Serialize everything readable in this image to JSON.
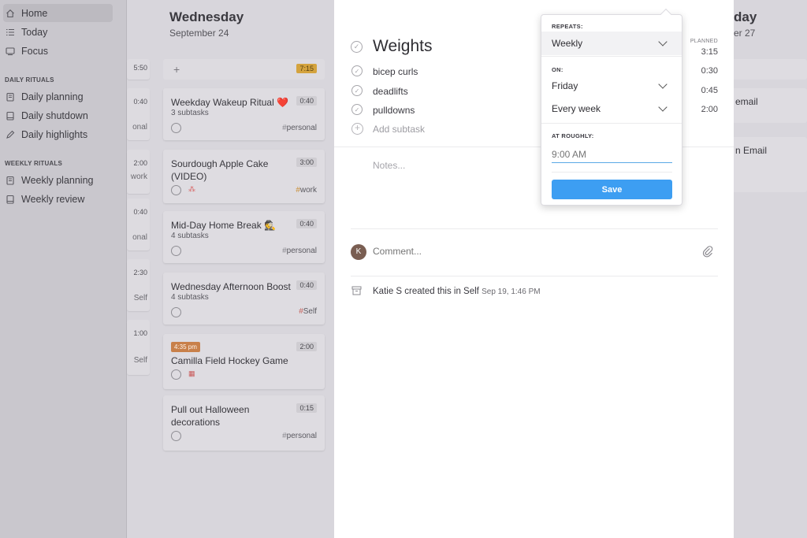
{
  "sidebar": {
    "items": [
      {
        "label": "Home",
        "icon": "home-icon"
      },
      {
        "label": "Today",
        "icon": "list-icon"
      },
      {
        "label": "Focus",
        "icon": "focus-icon"
      }
    ],
    "daily_rituals_heading": "DAILY RITUALS",
    "daily_rituals": [
      {
        "label": "Daily planning",
        "icon": "clipboard-icon"
      },
      {
        "label": "Daily shutdown",
        "icon": "notebook-icon"
      },
      {
        "label": "Daily highlights",
        "icon": "pen-icon"
      }
    ],
    "weekly_rituals_heading": "WEEKLY RITUALS",
    "weekly_rituals": [
      {
        "label": "Weekly planning",
        "icon": "clipboard-icon"
      },
      {
        "label": "Weekly review",
        "icon": "notebook-icon"
      }
    ]
  },
  "left_column": {
    "cards": [
      {
        "time": "5:50",
        "tag": ""
      },
      {
        "time": "0:40",
        "tag": "onal"
      },
      {
        "time": "2:00",
        "tag": "work"
      },
      {
        "time": "0:40",
        "tag": "onal"
      },
      {
        "time": "2:30",
        "tag": "Self"
      },
      {
        "time": "1:00",
        "tag": "Self"
      }
    ]
  },
  "wednesday": {
    "title": "Wednesday",
    "date": "September 24",
    "add_symbol": "+",
    "total": "7:15",
    "cards": [
      {
        "title": "Weekday Wakeup Ritual ❤️",
        "time": "0:40",
        "subtasks": "3 subtasks",
        "tag": "personal"
      },
      {
        "title": "Sourdough Apple Cake (VIDEO)",
        "time": "3:00",
        "subtasks": "",
        "tag": "work"
      },
      {
        "title": "Mid-Day Home Break 🕵️",
        "time": "0:40",
        "subtasks": "4 subtasks",
        "tag": "personal"
      },
      {
        "title": "Wednesday Afternoon Boost",
        "time": "0:40",
        "subtasks": "4 subtasks",
        "tag": "Self"
      },
      {
        "title": "Camilla Field Hockey Game",
        "time": "2:00",
        "chip": "4:35 pm",
        "tag": ""
      },
      {
        "title": "Pull out Halloween decorations",
        "time": "0:15",
        "subtasks": "",
        "tag": "personal"
      }
    ]
  },
  "right_column": {
    "title": "day",
    "date": "er 27",
    "cards": [
      "email",
      "n Email"
    ]
  },
  "task": {
    "title": "Weights",
    "planned_label": "PLANNED",
    "planned_total": "3:15",
    "subtasks": [
      {
        "label": "bicep curls",
        "time": "0:30"
      },
      {
        "label": "deadlifts",
        "time": "0:45"
      },
      {
        "label": "pulldowns",
        "time": "2:00"
      }
    ],
    "add_subtask": "Add subtask",
    "notes_placeholder": "Notes...",
    "avatar_initial": "K",
    "comment_placeholder": "Comment...",
    "activity_text": "Katie S created this in Self",
    "activity_time": "Sep 19, 1:46 PM"
  },
  "repeat_popup": {
    "repeats_label": "REPEATS:",
    "repeats_value": "Weekly",
    "on_label": "ON:",
    "day_value": "Friday",
    "frequency_value": "Every week",
    "at_label": "AT ROUGHLY:",
    "time_placeholder": "9:00 AM",
    "save_label": "Save"
  },
  "colors": {
    "accent": "#3d9ef2",
    "badge": "#d4a33e",
    "time_chip": "#c8804a"
  }
}
